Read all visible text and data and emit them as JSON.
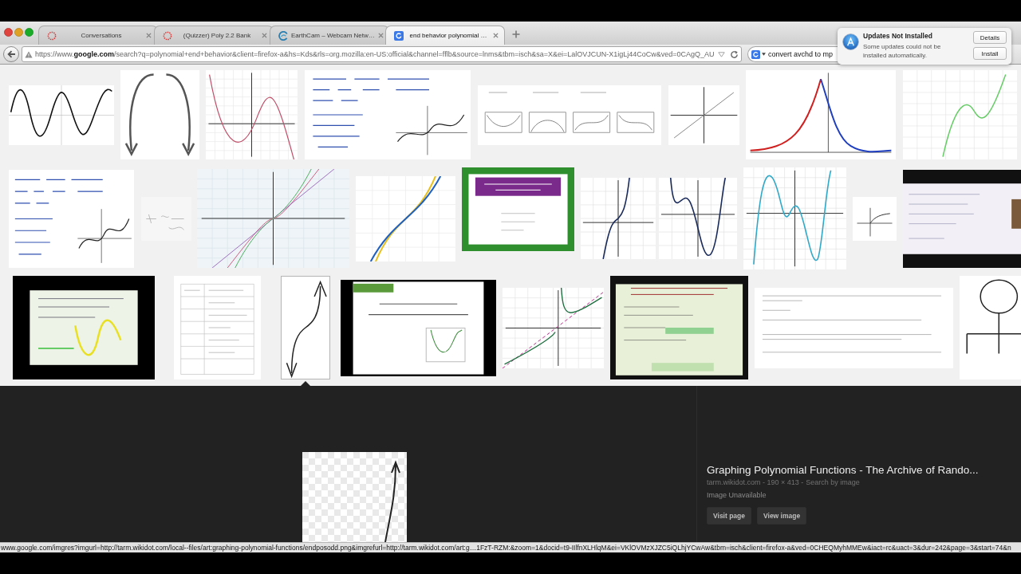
{
  "tabs": [
    {
      "title": "Conversations",
      "selected": false
    },
    {
      "title": "(Quizzer) Poly 2.2 Bank",
      "selected": false
    },
    {
      "title": "EarthCam – Webcam Netw…",
      "selected": false
    },
    {
      "title": "end behavior polynomial …",
      "selected": true
    }
  ],
  "toolbar": {
    "url": "https://www.**google.com**/search?q=polynomial+end+behavior&client=firefox-a&hs=Kds&rls=org.mozilla:en-US:official&channel=fflb&source=lnms&tbm=isch&sa=X&ei=LalOVJCUN-X1igLj44CoCw&ved=0CAgQ_AU",
    "search": {
      "value": "convert avchd to mp"
    }
  },
  "notification": {
    "title": "Updates Not Installed",
    "message": "Some updates could not be installed automatically.",
    "buttons": [
      "Details",
      "Install"
    ]
  },
  "results": {
    "rows": [
      {
        "thumbnails": [
          {
            "kind": "wave",
            "selected": false
          },
          {
            "kind": "arches",
            "selected": false
          },
          {
            "kind": "cubic",
            "selected": false
          },
          {
            "kind": "notes",
            "selected": false
          },
          {
            "kind": "panels",
            "selected": false
          },
          {
            "kind": "line",
            "selected": false
          },
          {
            "kind": "peak",
            "selected": false
          },
          {
            "kind": "bump",
            "selected": false
          }
        ]
      },
      {
        "thumbnails": [
          {
            "kind": "notes",
            "selected": false
          },
          {
            "kind": "sketch",
            "selected": false
          },
          {
            "kind": "lines",
            "selected": false
          },
          {
            "kind": "power",
            "selected": false
          },
          {
            "kind": "slide",
            "selected": false
          },
          {
            "kind": "rise",
            "selected": false
          },
          {
            "kind": "quartic",
            "selected": false
          },
          {
            "kind": "wiggle",
            "selected": false
          },
          {
            "kind": "root",
            "selected": false
          },
          {
            "kind": "screenshot",
            "selected": false
          }
        ]
      },
      {
        "thumbnails": [
          {
            "kind": "lesson",
            "selected": false
          },
          {
            "kind": "table",
            "selected": false
          },
          {
            "kind": "scurve",
            "selected": true
          },
          {
            "kind": "video",
            "selected": false
          },
          {
            "kind": "rational",
            "selected": false
          },
          {
            "kind": "lecture",
            "selected": false
          },
          {
            "kind": "text",
            "selected": false
          },
          {
            "kind": "figure",
            "selected": false
          }
        ]
      }
    ]
  },
  "preview": {
    "title": "Graphing Polynomial Functions - The Archive of Rando...",
    "source": "tarm.wikidot.com - 190 × 413 -",
    "search_link": "Search by image",
    "note": "Image Unavailable",
    "buttons": [
      "Visit page",
      "View image"
    ]
  },
  "status_bar": {
    "text": "www.google.com/imgres?imgurl=http://tarm.wikidot.com/local--files/art:graphing-polynomial-functions/endposodd.png&imgrefurl=http://tarm.wikidot.com/art:g…1FzT-RZM:&zoom=1&docid=t9-IIlfnXLHlqM&ei=VKlOVMzXJZC5iQLhjYCwAw&tbm=isch&client=firefox-a&ved=0CHEQMyhMMEw&iact=rc&uact=3&dur=242&page=3&start=74&n"
  }
}
